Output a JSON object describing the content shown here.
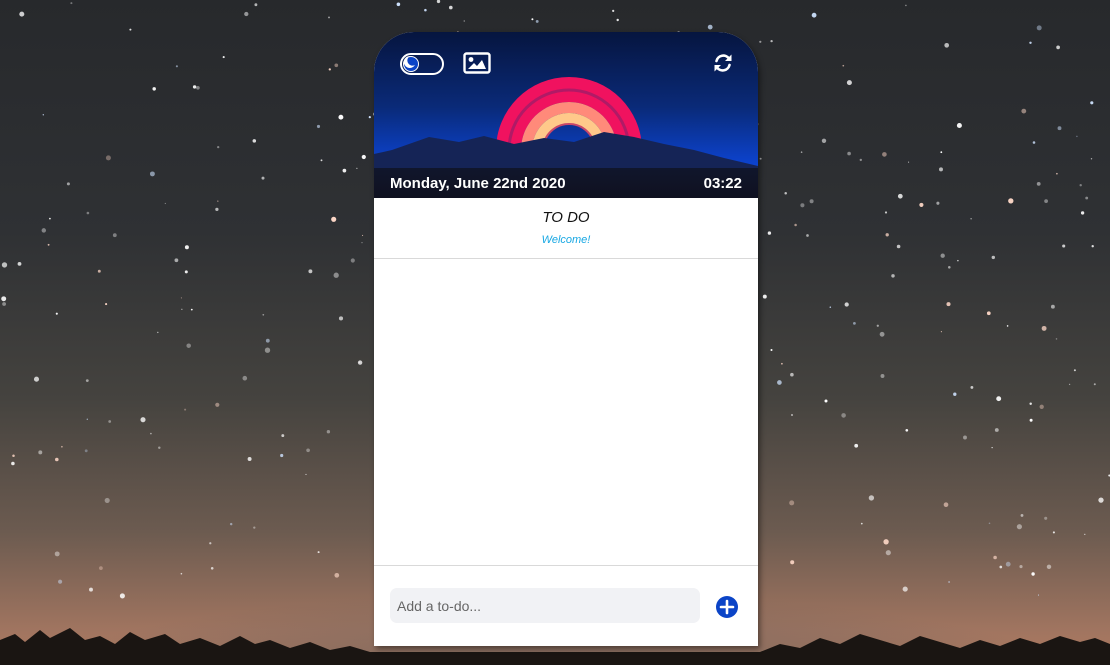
{
  "header": {
    "date": "Monday, June 22nd 2020",
    "time": "03:22",
    "icons": [
      "theme-toggle",
      "image-icon",
      "refresh-icon"
    ]
  },
  "todo": {
    "title": "TO DO",
    "subtitle": "Welcome!"
  },
  "footer": {
    "input_placeholder": "Add a to-do...",
    "input_value": "",
    "add_icon": "plus-circle-icon"
  },
  "colors": {
    "accent": "#0b44c7",
    "welcome_text": "#16a7e3",
    "arc_outer": "#f0125f",
    "arc_mid": "#ff8a7a",
    "arc_inner": "#ffc98a"
  }
}
